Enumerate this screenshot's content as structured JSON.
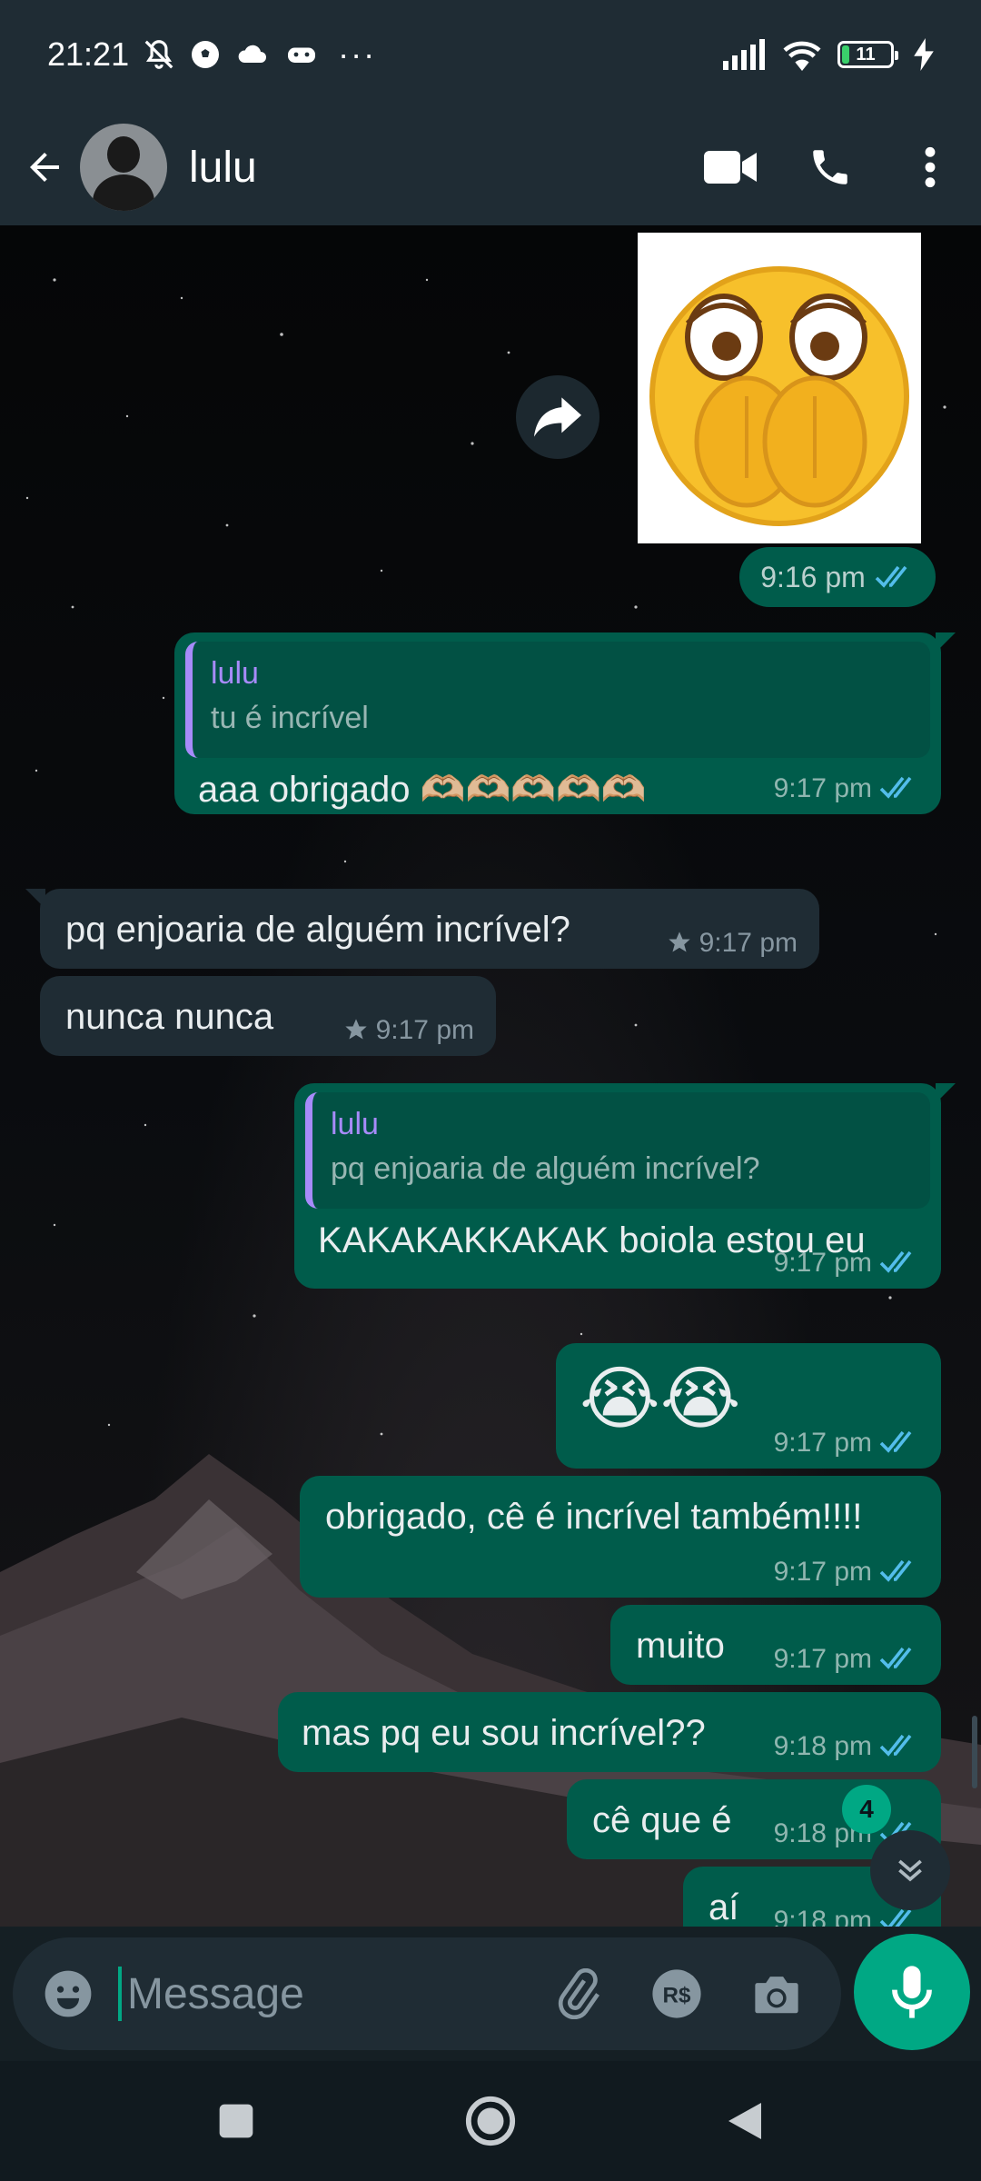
{
  "status_bar": {
    "time": "21:21",
    "more": "···",
    "battery_level": "11"
  },
  "header": {
    "contact_name": "lulu"
  },
  "sticker": {
    "time": "9:16 pm"
  },
  "messages": [
    {
      "direction": "out",
      "quote_author": "lulu",
      "quote_text": "tu é incrível",
      "text": "aaa obrigado 🫶🏼🫶🏼🫶🏼🫶🏼🫶🏼",
      "time": "9:17 pm"
    },
    {
      "direction": "in",
      "text": "pq enjoaria de alguém incrível?",
      "time": "9:17 pm",
      "starred": true
    },
    {
      "direction": "in",
      "text": "nunca nunca",
      "time": "9:17 pm",
      "starred": true
    },
    {
      "direction": "out",
      "quote_author": "lulu",
      "quote_text": "pq enjoaria de alguém incrível?",
      "text": "KAKAKAKKAKAK boiola estou eu",
      "time": "9:17 pm"
    },
    {
      "direction": "out",
      "text": "😭😭",
      "time": "9:17 pm"
    },
    {
      "direction": "out",
      "text": "obrigado, cê é incrível também!!!!",
      "time": "9:17 pm"
    },
    {
      "direction": "out",
      "text": "muito",
      "time": "9:17 pm"
    },
    {
      "direction": "out",
      "text": "mas pq eu sou incrível??",
      "time": "9:18 pm"
    },
    {
      "direction": "out",
      "text": "cê que é",
      "time": "9:18 pm"
    },
    {
      "direction": "out",
      "text": "aí",
      "time": "9:18 pm"
    }
  ],
  "unread_count": "4",
  "composer": {
    "placeholder": "Message"
  },
  "colors": {
    "accent": "#00a884",
    "outgoing_bubble": "#005c4b",
    "incoming_bubble": "#1f2c34",
    "read_ticks": "#53bdeb",
    "quote_author": "#a78bfa"
  },
  "icons": {
    "status": [
      "mute-bell-icon",
      "soccer-ball-icon",
      "cloud-icon",
      "gamepad-icon",
      "signal-icon",
      "wifi-icon",
      "battery-icon",
      "charging-icon"
    ],
    "header": [
      "back-arrow-icon",
      "video-call-icon",
      "phone-icon",
      "more-vert-icon"
    ],
    "composer": [
      "emoji-icon",
      "attach-icon",
      "payment-icon",
      "camera-icon",
      "mic-icon"
    ],
    "nav": [
      "recents-icon",
      "home-icon",
      "back-icon"
    ]
  }
}
